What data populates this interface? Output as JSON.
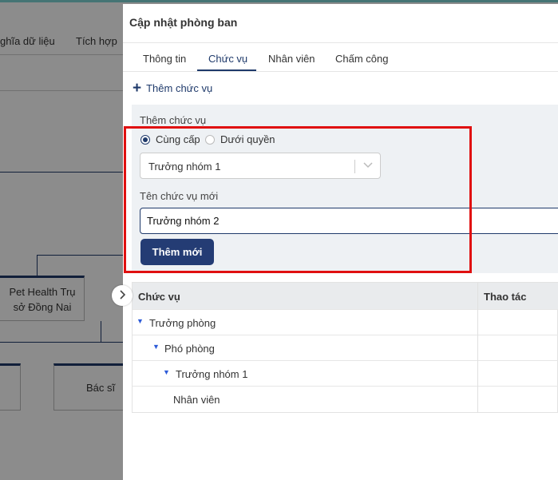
{
  "background": {
    "menu": [
      "ghĩa dữ liệu",
      "Tích hợp"
    ],
    "nodes": {
      "branch": "Pet Health Trụ sở Đồng Nai",
      "doctor": "Bác sĩ"
    }
  },
  "drawer": {
    "title": "Cập nhật phòng ban",
    "tabs": [
      "Thông tin",
      "Chức vụ",
      "Nhân viên",
      "Chấm công"
    ],
    "active_tab": "Chức vụ",
    "add_position_link": "Thêm chức vụ",
    "form": {
      "section_label": "Thêm chức vụ",
      "radio_same_level": "Cùng cấp",
      "radio_subordinate": "Dưới quyền",
      "selected_radio": "Cùng cấp",
      "parent_select_value": "Trưởng nhóm 1",
      "new_name_label": "Tên chức vụ mới",
      "new_name_value": "Trưởng nhóm 2",
      "submit_label": "Thêm mới"
    },
    "table": {
      "columns": [
        "Chức vụ",
        "Thao tác"
      ],
      "rows": [
        {
          "label": "Trưởng phòng",
          "expanded": true
        },
        {
          "label": "Phó phòng",
          "expanded": true
        },
        {
          "label": "Trưởng nhóm 1",
          "expanded": true
        },
        {
          "label": "Nhân viên",
          "expanded": false
        }
      ]
    }
  },
  "colors": {
    "primary": "#243c74",
    "highlight_box": "#e01010",
    "caret": "#2d5bd8"
  }
}
